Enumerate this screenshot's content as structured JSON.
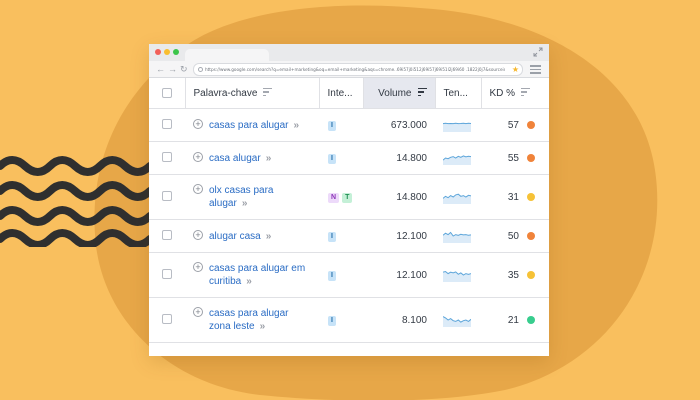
{
  "colors": {
    "background": "#F9BF5E",
    "blob": "#E7A748",
    "squiggle": "#2F2F2F",
    "link": "#2A6CC4",
    "kd_orange": "#F0833A",
    "kd_yellow": "#F6C237",
    "kd_green": "#38CD8E",
    "trend_line": "#5CA5DA",
    "trend_fill": "#DCEBF8"
  },
  "browser": {
    "url": "https://www.google.com/search?q=email+marketing&oq=email+marketing&aqs=chrome..69i57j0i512j69i57j69i51l2j69i60 .1822j0j7&sourceid..."
  },
  "icons": {
    "lock": "lock-icon",
    "star": "★",
    "back": "←",
    "forward": "→",
    "reload": "↻",
    "add": "+",
    "chevron": "»"
  },
  "table": {
    "headers": {
      "keyword": "Palavra-chave",
      "intent": "Inte...",
      "volume": "Volume",
      "trend": "Ten...",
      "kd": "KD %"
    },
    "rows": [
      {
        "keyword": "casas para alugar",
        "intents": [
          "I"
        ],
        "volume": "673.000",
        "kd": "57",
        "kd_color": "#F0833A",
        "trend": [
          0.6,
          0.62,
          0.6,
          0.61,
          0.6,
          0.62,
          0.6,
          0.61,
          0.63,
          0.6,
          0.62,
          0.61
        ]
      },
      {
        "keyword": "casa alugar",
        "intents": [
          "I"
        ],
        "volume": "14.800",
        "kd": "55",
        "kd_color": "#F0833A",
        "trend": [
          0.35,
          0.5,
          0.45,
          0.55,
          0.6,
          0.5,
          0.62,
          0.55,
          0.65,
          0.58,
          0.62,
          0.6
        ]
      },
      {
        "keyword": "olx casas para alugar",
        "intents": [
          "N",
          "T"
        ],
        "volume": "14.800",
        "kd": "31",
        "kd_color": "#F6C237",
        "trend": [
          0.4,
          0.55,
          0.45,
          0.6,
          0.5,
          0.65,
          0.7,
          0.55,
          0.6,
          0.5,
          0.62,
          0.58
        ]
      },
      {
        "keyword": "alugar casa",
        "intents": [
          "I"
        ],
        "volume": "12.100",
        "kd": "50",
        "kd_color": "#F0833A",
        "trend": [
          0.55,
          0.7,
          0.6,
          0.75,
          0.5,
          0.6,
          0.55,
          0.62,
          0.58,
          0.6,
          0.55,
          0.58
        ]
      },
      {
        "keyword": "casas para alugar em curitiba",
        "intents": [
          "I"
        ],
        "volume": "12.100",
        "kd": "35",
        "kd_color": "#F6C237",
        "trend": [
          0.7,
          0.75,
          0.6,
          0.7,
          0.65,
          0.72,
          0.55,
          0.65,
          0.5,
          0.6,
          0.55,
          0.6
        ]
      },
      {
        "keyword": "casas para alugar zona leste",
        "intents": [
          "I"
        ],
        "volume": "8.100",
        "kd": "21",
        "kd_color": "#38CD8E",
        "trend": [
          0.75,
          0.65,
          0.5,
          0.6,
          0.45,
          0.4,
          0.5,
          0.35,
          0.45,
          0.5,
          0.4,
          0.55
        ]
      }
    ]
  }
}
